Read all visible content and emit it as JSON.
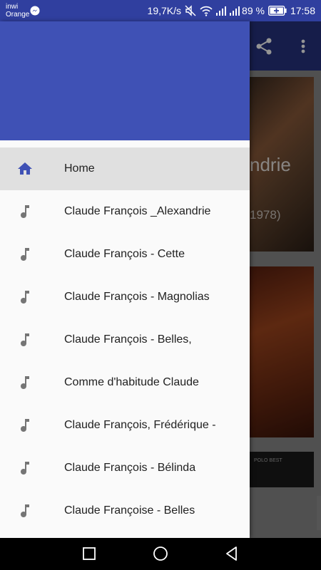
{
  "status_bar": {
    "carrier_line1": "inwi",
    "carrier_line2": "Orange",
    "network_speed": "19,7K/s",
    "battery_percent": "89 %",
    "time": "17:58"
  },
  "drawer": {
    "items": [
      {
        "label": "Home",
        "icon": "home-icon",
        "active": true
      },
      {
        "label": "Claude François _Alexandrie",
        "icon": "music-note-icon"
      },
      {
        "label": "Claude François - Cette",
        "icon": "music-note-icon"
      },
      {
        "label": "Claude François - Magnolias",
        "icon": "music-note-icon"
      },
      {
        "label": "Claude François - Belles,",
        "icon": "music-note-icon"
      },
      {
        "label": "Comme d'habitude Claude",
        "icon": "music-note-icon"
      },
      {
        "label": "Claude François, Frédérique -",
        "icon": "music-note-icon"
      },
      {
        "label": "Claude François - Bélinda",
        "icon": "music-note-icon"
      },
      {
        "label": "Claude Françoise - Belles",
        "icon": "music-note-icon"
      }
    ]
  },
  "background": {
    "card1_title": "ndrie",
    "card1_subtitle": "1978)",
    "card3_text": "POLO BEST"
  },
  "colors": {
    "primary": "#3f51b5",
    "primary_dark": "#303f9f",
    "active_icon": "#3f51b5",
    "inactive_icon": "#757575",
    "active_row": "#e0e0e0"
  }
}
